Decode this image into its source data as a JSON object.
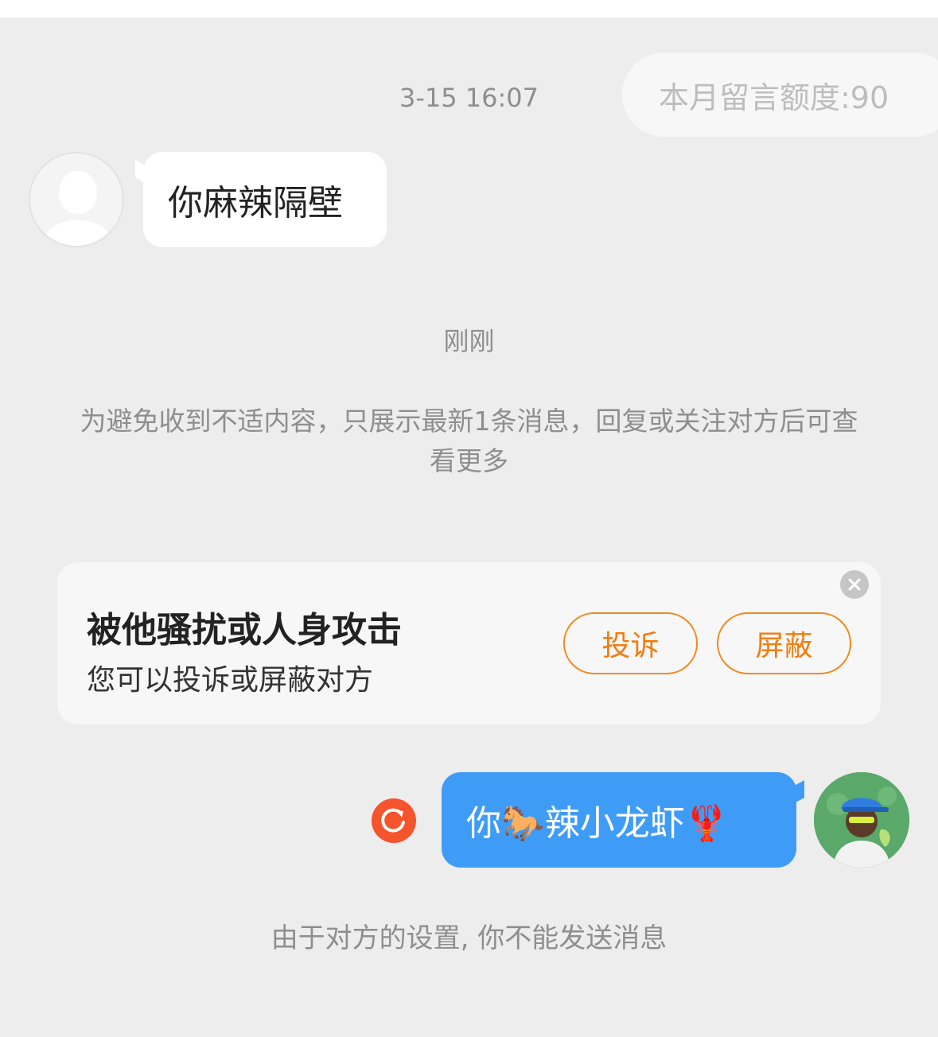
{
  "quota": {
    "label": "本月留言额度:90"
  },
  "messages": {
    "timestamp_1": "3-15 16:07",
    "incoming_text": "你麻辣隔壁",
    "timestamp_2": "刚刚",
    "notice": "为避免收到不适内容，只展示最新1条消息，回复或关注对方后可查看更多",
    "outgoing_text": "你🐎辣小龙虾🦞"
  },
  "report_card": {
    "title": "被他骚扰或人身攻击",
    "subtitle": "您可以投诉或屏蔽对方",
    "report_label": "投诉",
    "block_label": "屏蔽"
  },
  "footer": {
    "note": "由于对方的设置, 你不能发送消息"
  },
  "colors": {
    "accent_orange": "#f07d0f",
    "outgoing_bubble": "#3e9cf7",
    "retry_red": "#f5542d",
    "background": "#ededed"
  },
  "icons": {
    "default_avatar": "default-person-icon",
    "retry": "refresh-icon",
    "close": "close-icon"
  }
}
